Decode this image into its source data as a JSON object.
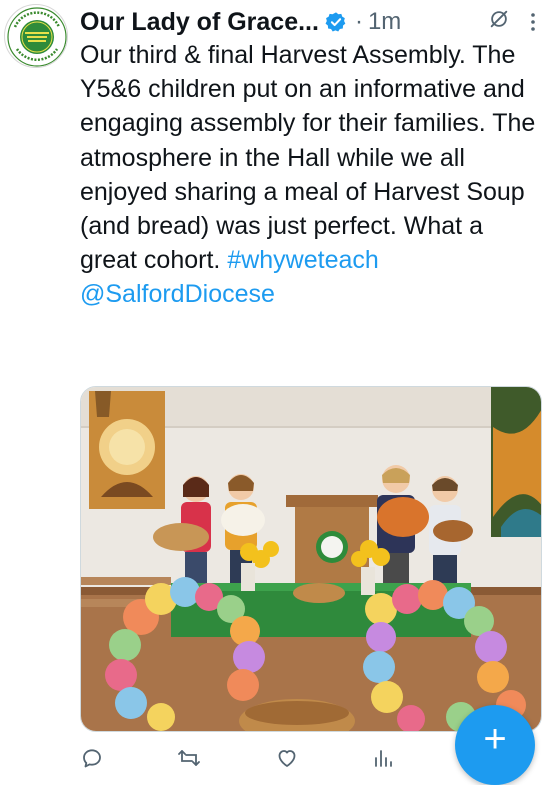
{
  "tweet": {
    "author_name": "Our Lady of Grace...",
    "separator": "·",
    "time": "1m",
    "text_main": "Our third & final Harvest Assembly. The Y5&6 children put on an informative and engaging assembly for their families. The atmosphere in the Hall while we all enjoyed sharing a meal of Harvest Soup (and bread) was just perfect. What a great cohort. ",
    "hashtag": "#whyweteach",
    "mention": "@SalfordDiocese"
  },
  "avatar": {
    "logo_text": "OUR LADY OF GRACE RC PRIMARY SCHOOL"
  },
  "colors": {
    "accent": "#1d9bf0",
    "text": "#0f1419",
    "muted": "#536471"
  },
  "icons": [
    "verified-badge-icon",
    "grok-icon",
    "more-options-icon",
    "reply-icon",
    "retweet-icon",
    "like-icon",
    "views-icon",
    "compose-plus-icon"
  ],
  "fab": {
    "label": "+"
  }
}
